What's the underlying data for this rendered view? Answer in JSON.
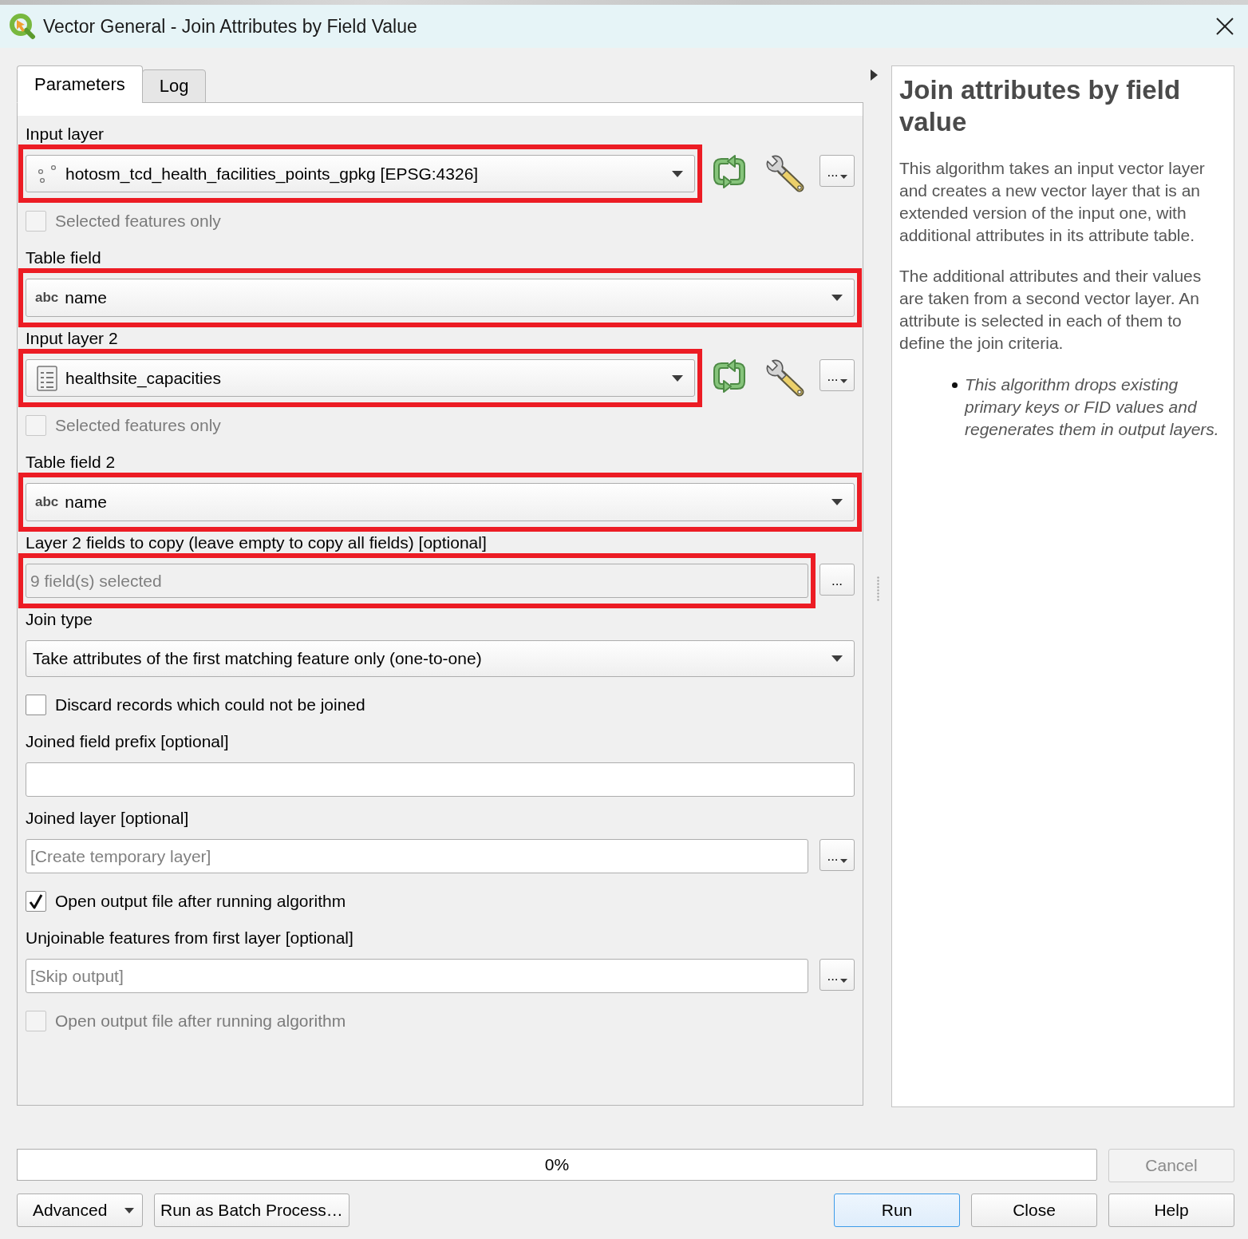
{
  "window": {
    "title": "Vector General - Join Attributes by Field Value"
  },
  "tabs": [
    {
      "label": "Parameters",
      "selected": true
    },
    {
      "label": "Log",
      "selected": false
    }
  ],
  "parameters": [
    {
      "kind": "label",
      "text": "Input layer"
    },
    {
      "kind": "layer_select",
      "layer": {
        "kind": "points",
        "name": "hotosm_tcd_health_facilities_points_gpkg [EPSG:4326]"
      },
      "highlighted": true,
      "browse_button": {
        "label": "...",
        "menu": true
      }
    },
    {
      "kind": "checkbox",
      "label": "Selected features only",
      "checked": false,
      "disabled": true
    },
    {
      "kind": "label",
      "text": "Table field"
    },
    {
      "kind": "field_select",
      "type_tag": "abc",
      "value": "name",
      "highlighted": true
    },
    {
      "kind": "label",
      "text": "Input layer 2"
    },
    {
      "kind": "layer_select",
      "layer": {
        "kind": "table",
        "name": "healthsite_capacities"
      },
      "highlighted": true,
      "browse_button": {
        "label": "...",
        "menu": true
      }
    },
    {
      "kind": "checkbox",
      "label": "Selected features only",
      "checked": false,
      "disabled": true
    },
    {
      "kind": "label",
      "text": "Table field 2"
    },
    {
      "kind": "field_select",
      "type_tag": "abc",
      "value": "name",
      "highlighted": true
    },
    {
      "kind": "label",
      "text": "Layer 2 fields to copy (leave empty to copy all fields) [optional]"
    },
    {
      "kind": "multi_select",
      "value": "9 field(s) selected",
      "highlighted": true,
      "browse_button": {
        "label": "...",
        "menu": false
      }
    },
    {
      "kind": "label",
      "text": "Join type"
    },
    {
      "kind": "select",
      "value": "Take attributes of the first matching feature only (one-to-one)",
      "highlighted": false
    },
    {
      "kind": "checkbox",
      "label": "Discard records which could not be joined",
      "checked": false,
      "disabled": false
    },
    {
      "kind": "label",
      "text": "Joined field prefix [optional]"
    },
    {
      "kind": "text_input",
      "highlighted": false
    },
    {
      "kind": "label",
      "text": "Joined layer [optional]"
    },
    {
      "kind": "output_input",
      "placeholder": "[Create temporary layer]",
      "highlighted": false,
      "browse_button": {
        "label": "...",
        "menu": true
      }
    },
    {
      "kind": "checkbox",
      "label": "Open output file after running algorithm",
      "checked": true,
      "disabled": false
    },
    {
      "kind": "label",
      "text": "Unjoinable features from first layer [optional]"
    },
    {
      "kind": "output_input",
      "placeholder": "[Skip output]",
      "highlighted": false,
      "browse_button": {
        "label": "...",
        "menu": true
      }
    },
    {
      "kind": "checkbox",
      "label": "Open output file after running algorithm",
      "checked": false,
      "disabled": true
    }
  ],
  "help": {
    "title": "Join attributes by field value",
    "paragraphs": [
      "This algorithm takes an input vector layer and creates a new vector layer that is an extended version of the input one, with additional attributes in its attribute table.",
      "The additional attributes and their values are taken from a second vector layer. An attribute is selected in each of them to define the join criteria."
    ],
    "notes": [
      "This algorithm drops existing primary keys or FID values and regenerates them in output layers."
    ]
  },
  "progress": {
    "level": 0,
    "reading": "0%"
  },
  "cancel_button": {
    "label": "Cancel",
    "disabled": true
  },
  "left_buttons": [
    {
      "label": "Advanced",
      "menu": true
    },
    {
      "label": "Run as Batch Process…",
      "menu": false
    }
  ],
  "right_buttons": [
    {
      "label": "Run",
      "default": true
    },
    {
      "label": "Close",
      "default": false
    },
    {
      "label": "Help",
      "default": false
    }
  ]
}
